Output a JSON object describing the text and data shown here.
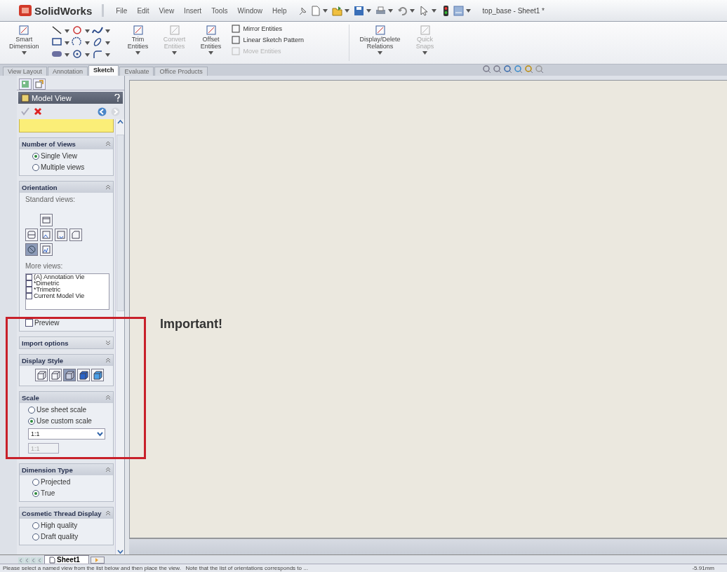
{
  "app": {
    "logo": "SolidWorks",
    "menus": [
      "File",
      "Edit",
      "View",
      "Insert",
      "Tools",
      "Window",
      "Help"
    ],
    "document_title": "top_base - Sheet1 *"
  },
  "ribbon": {
    "items": [
      {
        "kind": "large",
        "label": "Smart Dimension",
        "disabled": false
      },
      {
        "kind": "tools"
      },
      {
        "kind": "large",
        "label": "Trim Entities",
        "disabled": false
      },
      {
        "kind": "large",
        "label": "Convert Entities",
        "disabled": true
      },
      {
        "kind": "large",
        "label": "Offset Entities",
        "disabled": false
      },
      {
        "kind": "list",
        "entries": [
          {
            "label": "Mirror Entities",
            "disabled": false
          },
          {
            "label": "Linear Sketch Pattern",
            "disabled": false
          },
          {
            "label": "Move Entities",
            "disabled": true
          }
        ]
      },
      {
        "kind": "large",
        "label": "Display/Delete Relations",
        "disabled": false
      },
      {
        "kind": "large",
        "label": "Quick Snaps",
        "disabled": true
      }
    ]
  },
  "tabs": [
    {
      "label": "View Layout",
      "selected": false
    },
    {
      "label": "Annotation",
      "selected": false
    },
    {
      "label": "Sketch",
      "selected": true
    },
    {
      "label": "Evaluate",
      "selected": false
    },
    {
      "label": "Office Products",
      "selected": false
    }
  ],
  "panel": {
    "title": "Model View",
    "sections": [
      {
        "kind": "radios",
        "title": "Number of Views",
        "expanded": true,
        "options": [
          {
            "label": "Single View",
            "selected": true
          },
          {
            "label": "Multiple views",
            "selected": false
          }
        ]
      },
      {
        "kind": "orientation",
        "title": "Orientation",
        "expanded": true,
        "standard_views_label": "Standard views:",
        "standard_views": [
          {
            "selected": false
          },
          {
            "selected": false
          },
          {
            "selected": false
          },
          {
            "selected": false
          },
          {
            "selected": false
          },
          {
            "selected": true
          },
          {
            "selected": false
          }
        ],
        "more_views_label": "More views:",
        "more_views": [
          {
            "label": "(A) Annotation Vie",
            "checked": false
          },
          {
            "label": "*Dimetric",
            "checked": false
          },
          {
            "label": "*Trimetric",
            "checked": false
          },
          {
            "label": "Current Model Vie",
            "checked": false
          }
        ],
        "preview": {
          "label": "Preview",
          "checked": false
        }
      },
      {
        "kind": "collapsed",
        "title": "Import options",
        "expanded": false
      },
      {
        "kind": "styles",
        "title": "Display Style",
        "expanded": true,
        "styles": [
          {
            "selected": false
          },
          {
            "selected": false
          },
          {
            "selected": true
          },
          {
            "selected": false
          },
          {
            "selected": false
          }
        ]
      },
      {
        "kind": "scale",
        "title": "Scale",
        "expanded": true,
        "options": [
          {
            "label": "Use sheet scale",
            "selected": false
          },
          {
            "label": "Use custom scale",
            "selected": true
          }
        ],
        "dropdown": {
          "value": "1:1"
        },
        "custom_field": {
          "value": "1:1",
          "disabled": true
        }
      },
      {
        "kind": "radios",
        "title": "Dimension Type",
        "expanded": true,
        "options": [
          {
            "label": "Projected",
            "selected": false
          },
          {
            "label": "True",
            "selected": true
          }
        ]
      },
      {
        "kind": "radios",
        "title": "Cosmetic Thread Display",
        "expanded": true,
        "options": [
          {
            "label": "High quality",
            "selected": false
          },
          {
            "label": "Draft quality",
            "selected": false
          }
        ]
      }
    ]
  },
  "annotation": {
    "label": "Important!"
  },
  "sheet_tabs": [
    {
      "label": "Sheet1",
      "selected": true
    }
  ],
  "status_bar": {
    "message": "Please select a named view from the list below and then place the view.   Note that the list of orientations corresponds to ...",
    "coordinate": "-5.91mm"
  }
}
